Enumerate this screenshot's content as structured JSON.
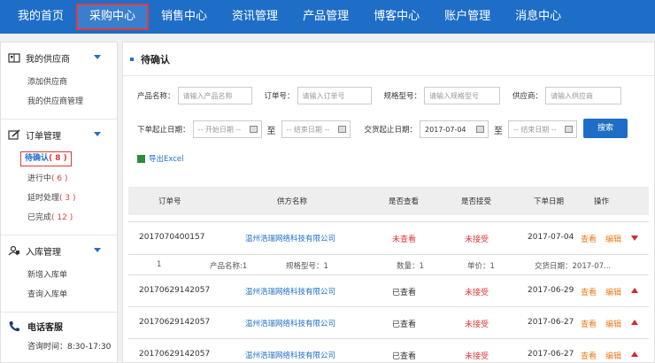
{
  "nav": {
    "items": [
      "我的首页",
      "采购中心",
      "销售中心",
      "资讯管理",
      "产品管理",
      "博客中心",
      "账户管理",
      "消息中心"
    ],
    "active_index": 1
  },
  "sidebar": {
    "supplier": {
      "title": "我的供应商",
      "icon": "supplier-book-icon",
      "items": [
        "添加供应商",
        "我的供应商管理"
      ]
    },
    "orders": {
      "title": "订单管理",
      "icon": "edit-order-icon",
      "items": [
        {
          "label": "待确认",
          "count": "( 8 )"
        },
        {
          "label": "进行中",
          "count": "( 6 )"
        },
        {
          "label": "延时处理",
          "count": "( 3 )"
        },
        {
          "label": "已完成",
          "count": "( 12 )"
        }
      ]
    },
    "warehouse": {
      "title": "入库管理",
      "icon": "warehouse-user-icon",
      "items": [
        "新增入库单",
        "查询入库单"
      ]
    },
    "phone": {
      "title": "电话客服",
      "icon": "phone-icon",
      "time": "咨询时间：8:30-17:30"
    }
  },
  "main": {
    "title": "待确认",
    "filters": {
      "product_label": "产品名称：",
      "product_placeholder": "请输入产品名称",
      "order_label": "订单号：",
      "order_placeholder": "请输入订单号",
      "spec_label": "规格型号：",
      "spec_placeholder": "请输入规格型号",
      "supplier_label": "供应商：",
      "supplier_placeholder": "请输入供应商",
      "order_date_label": "下单起止日期：",
      "start_placeholder": "-- 开始日期 --",
      "end_placeholder": "-- 结束日期 --",
      "trade_date_label": "交货起止日期：",
      "trade_start_value": "2017-07-04",
      "trade_end_placeholder": "-- 结束日期 --",
      "tilde": "至",
      "search_button": "搜索"
    },
    "export_label": "导出Excel",
    "table": {
      "headers": [
        "订单号",
        "供方名称",
        "是否查看",
        "是否接受",
        "下单日期",
        "操作"
      ],
      "rows": [
        {
          "order_no": "2017070400157",
          "supplier": "温州浩瑞网络科技有限公司",
          "viewed": "未查看",
          "accepted": "未接受",
          "date": "2017-07-04",
          "view": "查看",
          "edit": "编辑",
          "expanded": true
        },
        {
          "order_no": "20170629142057",
          "supplier": "温州浩瑞网络科技有限公司",
          "viewed": "已查看",
          "accepted": "未接受",
          "date": "2017-06-29",
          "view": "查看",
          "edit": "编辑",
          "expanded": false
        },
        {
          "order_no": "20170629142057",
          "supplier": "温州浩瑞网络科技有限公司",
          "viewed": "已查看",
          "accepted": "未接受",
          "date": "2017-06-27",
          "view": "查看",
          "edit": "编辑",
          "expanded": false
        },
        {
          "order_no": "20170629142057",
          "supplier": "温州浩瑞网络科技有限公司",
          "viewed": "已查看",
          "accepted": "未接受",
          "date": "2017-06-27",
          "view": "查看",
          "edit": "编辑",
          "expanded": false
        }
      ],
      "detail": {
        "index": "1",
        "product": "产品名称:1",
        "spec": "规格型号：1",
        "qty": "数量：1",
        "price": "单价：1",
        "trade_date": "交货日期：2017-07..."
      }
    }
  },
  "colors": {
    "nav_bg": "#1e6ec8",
    "active_border": "#e23c3c",
    "link": "#1e6ec8",
    "red": "#e03a3a",
    "orange": "#f07a1a"
  }
}
